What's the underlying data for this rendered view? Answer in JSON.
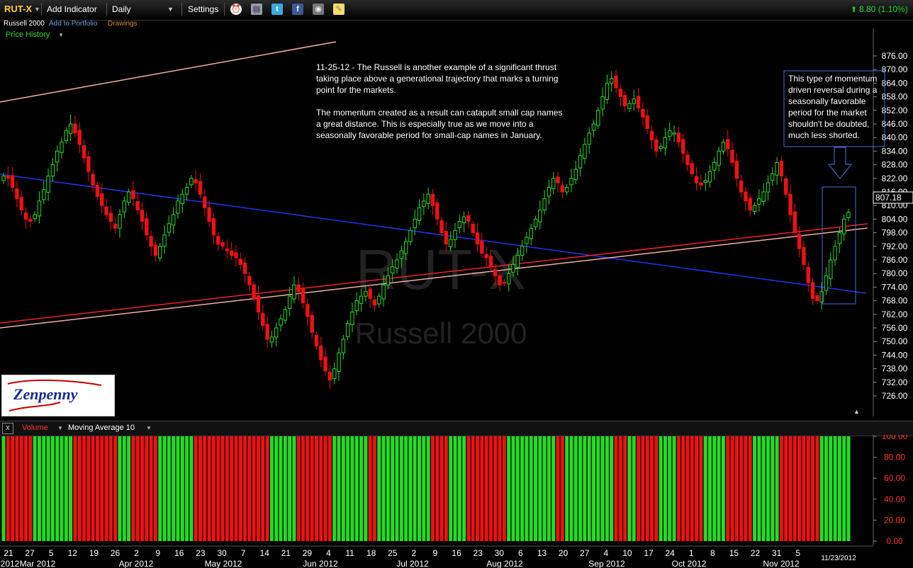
{
  "toolbar": {
    "symbol": "RUT-X",
    "add_indicator": "Add Indicator",
    "period": "Daily",
    "settings": "Settings",
    "change": "8.80 (1.10%)",
    "up_color": "#22cc33"
  },
  "subheader": {
    "name": "Russell 2000",
    "add_to_portfolio": "Add to Portfolio",
    "drawings": "Drawings",
    "price_history": "Price History"
  },
  "watermark": {
    "symbol": "RUT-X",
    "name": "Russell 2000"
  },
  "annotations": {
    "main_note_p1": "11-25-12 - The Russell is another example of a significant thrust taking place above a generational trajectory that marks a turning point for the markets.",
    "main_note_p2": "The momentum created as a result can catapult small cap names a great distance. This is especially true as we move into a seasonally favorable period for small-cap names in January.",
    "box_note": "This type of momentum driven reversal during a seasonally favorable period for the market shouldn't be doubted, much less shorted."
  },
  "logo": {
    "text": "Zenpenny"
  },
  "volume_panel": {
    "title": "Volume",
    "indicator": "Moving Average 10",
    "close_glyph": "x"
  },
  "date_axis": {
    "days": [
      "21",
      "27",
      "5",
      "12",
      "19",
      "26",
      "2",
      "9",
      "16",
      "23",
      "30",
      "7",
      "14",
      "21",
      "29",
      "4",
      "11",
      "18",
      "25",
      "2",
      "9",
      "16",
      "23",
      "30",
      "6",
      "13",
      "20",
      "27",
      "4",
      "10",
      "17",
      "24",
      "1",
      "8",
      "15",
      "22",
      "31",
      "5"
    ],
    "months": [
      "2012",
      "Mar 2012",
      "Apr 2012",
      "May 2012",
      "Jun 2012",
      "Jul 2012",
      "Aug 2012",
      "Sep 2012",
      "Oct 2012",
      "Nov 2012"
    ],
    "current_date": "11/23/2012"
  },
  "chart_data": {
    "type": "candlestick",
    "symbol": "RUT-X",
    "period": "Daily",
    "last_price": 807.18,
    "price_ticks": [
      876,
      870,
      864,
      858,
      852,
      846,
      840,
      834,
      828,
      822,
      816,
      810,
      804,
      798,
      792,
      786,
      780,
      774,
      768,
      762,
      756,
      750,
      744,
      738,
      732,
      726
    ],
    "price_tick_labels": [
      "876.00",
      "870.00",
      "864.00",
      "858.00",
      "852.00",
      "846.00",
      "840.00",
      "834.00",
      "828.00",
      "822.00",
      "816.00",
      "810.00",
      "804.00",
      "798.00",
      "792.00",
      "786.00",
      "780.00",
      "774.00",
      "768.00",
      "762.00",
      "756.00",
      "750.00",
      "744.00",
      "738.00",
      "732.00",
      "726.00"
    ],
    "ylim": [
      722,
      880
    ],
    "volume_ticks": [
      100,
      80,
      60,
      40,
      20,
      0
    ],
    "volume_tick_labels": [
      "100.00",
      "80.00",
      "60.00",
      "40.00",
      "20.00",
      "0.00"
    ],
    "volume_ylim": [
      0,
      100
    ],
    "closes": [
      823,
      822,
      818,
      813,
      808,
      804,
      803,
      806,
      812,
      817,
      823,
      828,
      834,
      838,
      843,
      846,
      842,
      837,
      831,
      825,
      819,
      814,
      810,
      806,
      803,
      800,
      806,
      812,
      816,
      813,
      808,
      803,
      797,
      792,
      788,
      792,
      797,
      802,
      806,
      812,
      815,
      818,
      822,
      820,
      815,
      809,
      803,
      797,
      793,
      792,
      790,
      788,
      787,
      784,
      780,
      775,
      769,
      763,
      757,
      751,
      752,
      756,
      760,
      764,
      770,
      775,
      772,
      767,
      761,
      754,
      748,
      742,
      737,
      733,
      738,
      745,
      751,
      758,
      763,
      768,
      770,
      772,
      769,
      766,
      770,
      775,
      779,
      783,
      786,
      790,
      794,
      799,
      804,
      809,
      812,
      815,
      810,
      804,
      798,
      793,
      795,
      799,
      803,
      805,
      803,
      798,
      793,
      789,
      787,
      783,
      779,
      775,
      776,
      780,
      784,
      788,
      792,
      796,
      800,
      804,
      808,
      813,
      818,
      822,
      820,
      816,
      818,
      822,
      826,
      832,
      837,
      842,
      846,
      852,
      858,
      864,
      866,
      862,
      858,
      854,
      855,
      857,
      853,
      849,
      844,
      839,
      834,
      836,
      840,
      843,
      842,
      838,
      833,
      828,
      824,
      820,
      819,
      821,
      825,
      829,
      834,
      838,
      835,
      829,
      822,
      816,
      812,
      808,
      810,
      813,
      816,
      820,
      824,
      829,
      823,
      815,
      806,
      798,
      791,
      784,
      776,
      769,
      768,
      772,
      779,
      786,
      792,
      798,
      804,
      807
    ]
  }
}
